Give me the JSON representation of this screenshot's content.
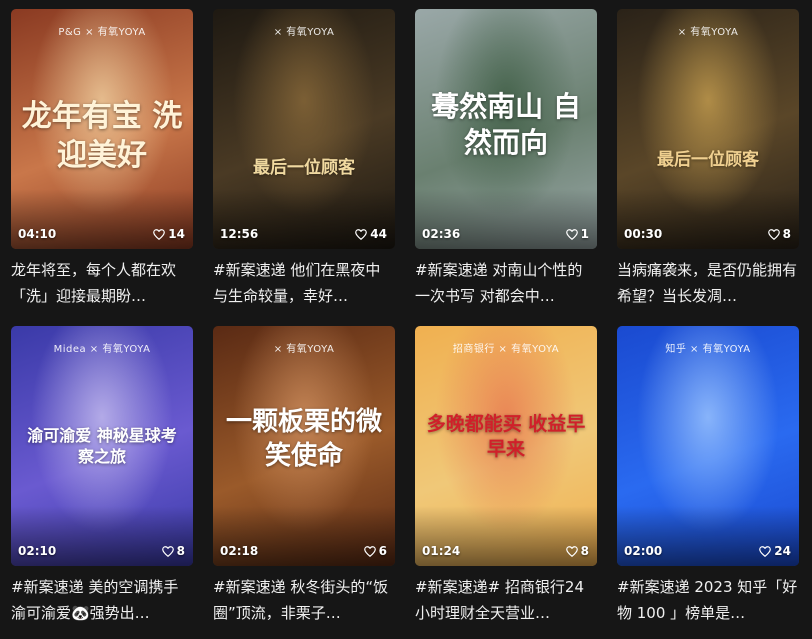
{
  "cards": [
    {
      "duration": "04:10",
      "likes": "14",
      "title": "龙年将至，每个人都在欢「洗」迎接最期盼…",
      "brand": "P&G × 有氧YOYA",
      "poster": "龙年有宝 洗迎美好",
      "colors": [
        "#8a3a22",
        "#c9774a",
        "#f0d0a0"
      ]
    },
    {
      "duration": "12:56",
      "likes": "44",
      "title": "#新案速递 他们在黑夜中与生命较量，幸好…",
      "brand": "× 有氧YOYA",
      "poster": "最后一位顾客",
      "colors": [
        "#1e1912",
        "#4a3a24",
        "#8a6a3a"
      ]
    },
    {
      "duration": "02:36",
      "likes": "1",
      "title": "#新案速递 对南山个性的一次书写 对都会中…",
      "brand": "",
      "poster": "蓦然南山 自然而向",
      "colors": [
        "#9aa8a8",
        "#6a8070",
        "#3a5a40"
      ]
    },
    {
      "duration": "00:30",
      "likes": "8",
      "title": "当病痛袭来，是否仍能拥有希望？当长发凋…",
      "brand": "× 有氧YOYA",
      "poster": "最后一位顾客",
      "colors": [
        "#2a2218",
        "#5a4628",
        "#c8a050"
      ]
    },
    {
      "duration": "02:10",
      "likes": "8",
      "title": "#新案速递 美的空调携手渝可渝爱🐼强势出…",
      "brand": "Midea × 有氧YOYA",
      "poster": "渝可渝爱 神秘星球考察之旅",
      "colors": [
        "#3a3aa8",
        "#6a5ad0",
        "#c8c0f0"
      ]
    },
    {
      "duration": "02:18",
      "likes": "6",
      "title": "#新案速递 秋冬街头的“饭圈”顶流，非栗子…",
      "brand": "× 有氧YOYA",
      "poster": "一颗板栗的微笑使命",
      "colors": [
        "#5a2a14",
        "#9a5a2a",
        "#d09060"
      ]
    },
    {
      "duration": "01:24",
      "likes": "8",
      "title": "#新案速递# 招商银行24小时理财全天营业…",
      "brand": "招商银行 × 有氧YOYA",
      "poster": "多晚都能买 收益早早来",
      "colors": [
        "#f0b050",
        "#f0c878",
        "#e87850"
      ]
    },
    {
      "duration": "02:00",
      "likes": "24",
      "title": "#新案速递 2023 知乎「好物 100 」榜单是…",
      "brand": "知乎 × 有氧YOYA",
      "poster": "",
      "colors": [
        "#1a4ad0",
        "#2a6af0",
        "#a0c8ff"
      ]
    }
  ]
}
